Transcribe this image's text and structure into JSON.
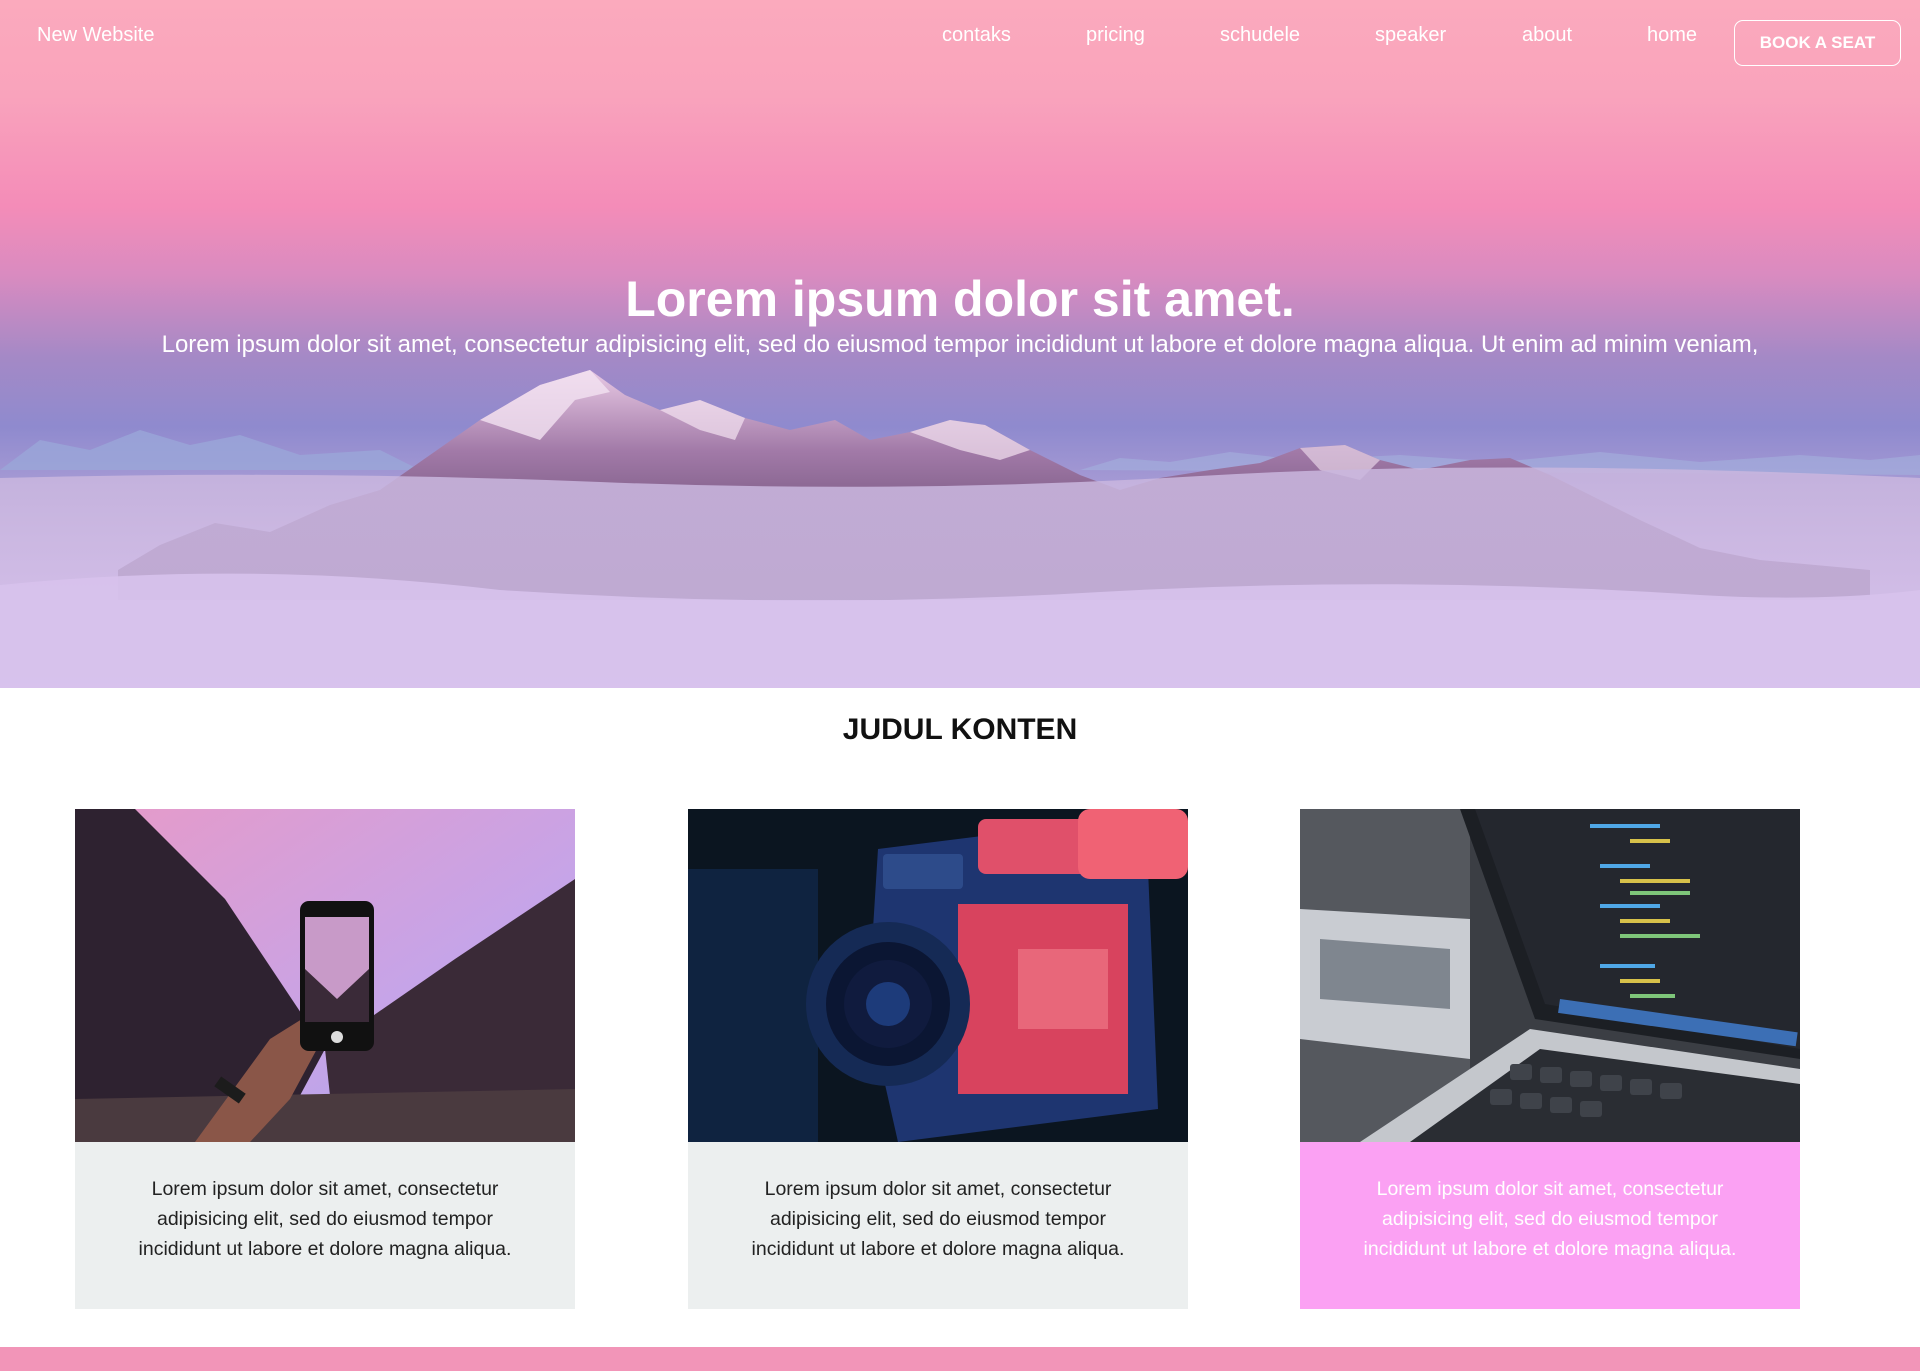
{
  "navbar": {
    "brand": "New Website",
    "links": [
      "contaks",
      "pricing",
      "schudele",
      "speaker",
      "about",
      "home"
    ],
    "cta_label": "BOOK A SEAT"
  },
  "hero": {
    "title": "Lorem ipsum dolor sit amet.",
    "subtitle": "Lorem ipsum dolor sit amet, consectetur adipisicing elit, sed do eiusmod tempor incididunt ut labore et dolore magna aliqua. Ut enim ad minim veniam,"
  },
  "section": {
    "title": "JUDUL KONTEN",
    "cards": [
      {
        "image": "phone-photo-mountain-valley",
        "text": "Lorem ipsum dolor sit amet, consectetur adipisicing elit, sed do eiusmod tempor incididunt ut labore et dolore magna aliqua."
      },
      {
        "image": "video-camera",
        "text": "Lorem ipsum dolor sit amet, consectetur adipisicing elit, sed do eiusmod tempor incididunt ut labore et dolore magna aliqua."
      },
      {
        "image": "laptop-code-editor",
        "text": "Lorem ipsum dolor sit amet, consectetur adipisicing elit, sed do eiusmod tempor incididunt ut labore et dolore magna aliqua."
      }
    ]
  },
  "colors": {
    "sky_top": "#fbaabd",
    "sky_pink": "#f48cb8",
    "sky_violet": "#8f8ace",
    "card_body": "#ecefef",
    "card_highlight": "#fba1f3",
    "footer": "#f295b8"
  }
}
